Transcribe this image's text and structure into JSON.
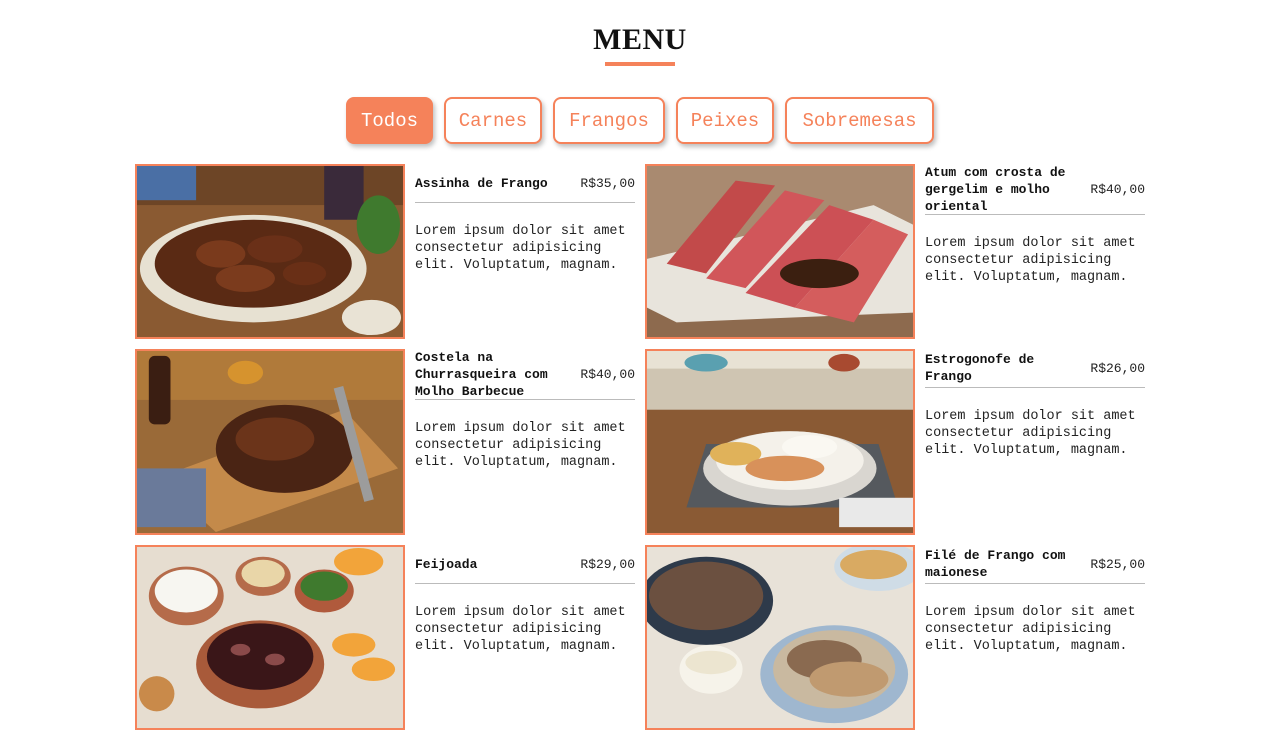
{
  "page": {
    "title": "MENU"
  },
  "filters": [
    {
      "label": "Todos"
    },
    {
      "label": "Carnes"
    },
    {
      "label": "Frangos"
    },
    {
      "label": "Peixes"
    },
    {
      "label": "Sobremesas"
    }
  ],
  "items": [
    {
      "name": "Assinha de Frango",
      "price": "R$35,00",
      "description": "Lorem ipsum dolor sit amet consectetur adipisicing elit. Voluptatum, magnam."
    },
    {
      "name": "Atum com crosta de gergelim e molho oriental",
      "price": "R$40,00",
      "description": "Lorem ipsum dolor sit amet consectetur adipisicing elit. Voluptatum, magnam."
    },
    {
      "name": "Costela na Churrasqueira com Molho Barbecue",
      "price": "R$40,00",
      "description": "Lorem ipsum dolor sit amet consectetur adipisicing elit. Voluptatum, magnam."
    },
    {
      "name": "Estrogonofe de Frango",
      "price": "R$26,00",
      "description": "Lorem ipsum dolor sit amet consectetur adipisicing elit. Voluptatum, magnam."
    },
    {
      "name": "Feijoada",
      "price": "R$29,00",
      "description": "Lorem ipsum dolor sit amet consectetur adipisicing elit. Voluptatum, magnam."
    },
    {
      "name": "Filé de Frango com maionese",
      "price": "R$25,00",
      "description": "Lorem ipsum dolor sit amet consectetur adipisicing elit. Voluptatum, magnam."
    }
  ],
  "colors": {
    "accent": "#f5825a"
  }
}
